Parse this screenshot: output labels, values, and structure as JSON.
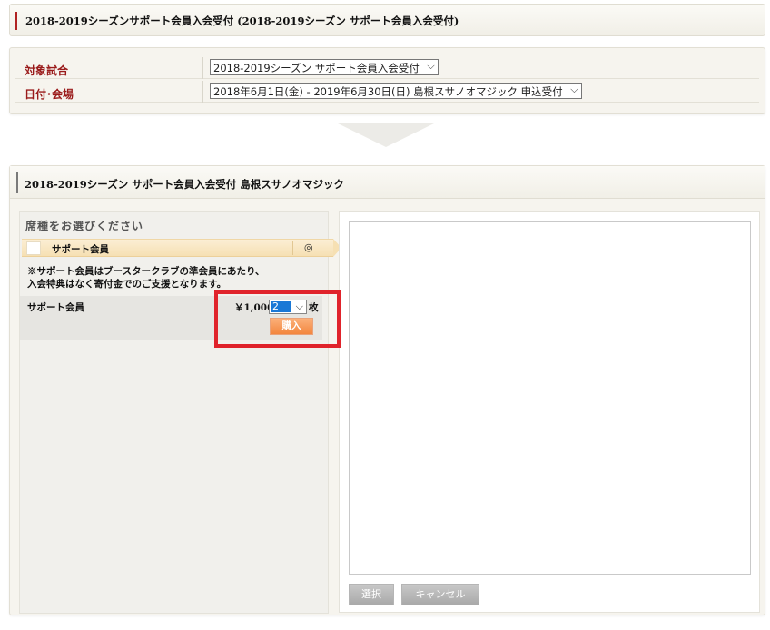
{
  "page_title": "2018-2019シーズンサポート会員入会受付 (2018-2019シーズン サポート会員入会受付)",
  "form": {
    "match_label": "対象試合",
    "match_value": "2018-2019シーズン サポート会員入会受付",
    "date_label": "日付･会場",
    "date_value": "2018年6月1日(金) - 2019年6月30日(日) 島根スサノオマジック 申込受付"
  },
  "event": {
    "title": "2018-2019シーズン サポート会員入会受付 島根スサノオマジック"
  },
  "seats": {
    "heading": "席種をお選びください",
    "type_name": "サポート会員",
    "type_mark": "◎",
    "note_line1": "※サポート会員はブースタークラブの準会員にあたり、",
    "note_line2": "入会特典はなく寄付金でのご支援となります。",
    "ticket": {
      "name": "サポート会員",
      "price": "￥1,000",
      "quantity": "2",
      "unit": "枚",
      "buy_label": "購入"
    }
  },
  "actions": {
    "select_label": "選択",
    "cancel_label": "キャンセル"
  },
  "colors": {
    "accent_red": "#b02222",
    "label_red": "#9a1b1b",
    "highlight": "#e0232b",
    "buy_orange": "#f3863e",
    "seat_band": "#f6e0b3"
  }
}
